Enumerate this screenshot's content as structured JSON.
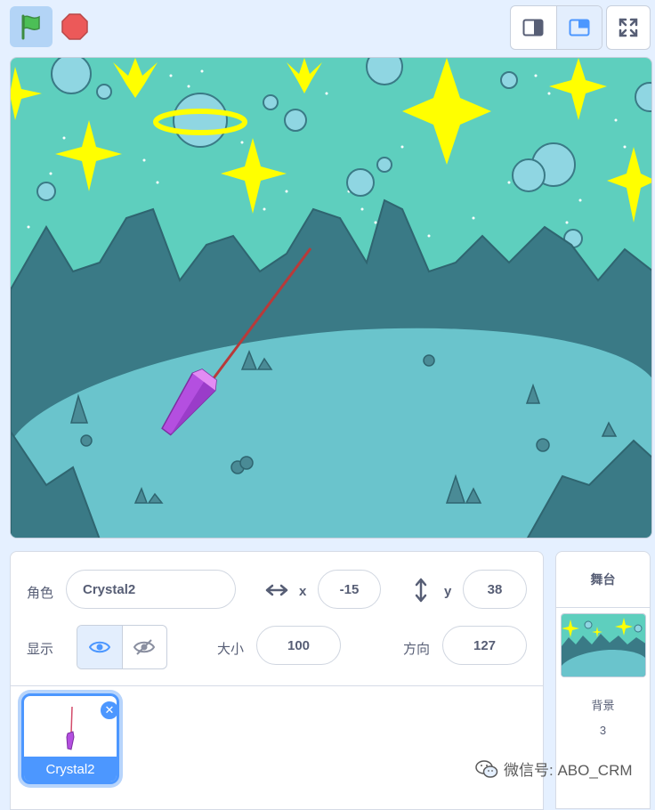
{
  "stage_controls": {
    "flag_icon": "green-flag-icon",
    "stop_icon": "stop-sign-icon",
    "small_stage_icon": "small-stage-icon",
    "normal_stage_icon": "normal-stage-icon",
    "fullscreen_icon": "fullscreen-icon"
  },
  "sprite_info": {
    "sprite_label": "角色",
    "sprite_name": "Crystal2",
    "x_label": "x",
    "x_value": "-15",
    "y_label": "y",
    "y_value": "38",
    "show_label": "显示",
    "size_label": "大小",
    "size_value": "100",
    "direction_label": "方向",
    "direction_value": "127"
  },
  "sprite_list": [
    {
      "name": "Crystal2",
      "selected": true
    }
  ],
  "stage_panel": {
    "title": "舞台",
    "backdrops_label": "背景",
    "backdrops_count": "3"
  },
  "watermark": "微信号: ABO_CRM",
  "colors": {
    "accent": "#4c97ff",
    "background": "#e5f0ff",
    "text": "#575e75",
    "sky": "#5ecfbe",
    "ground": "#6ac4cc",
    "mountain": "#3a7a86",
    "star": "#ffff00",
    "crystal": "#b44fe0",
    "pen_line": "#b83a3a",
    "stop": "#ec5959",
    "flag": "#4cbf56"
  }
}
